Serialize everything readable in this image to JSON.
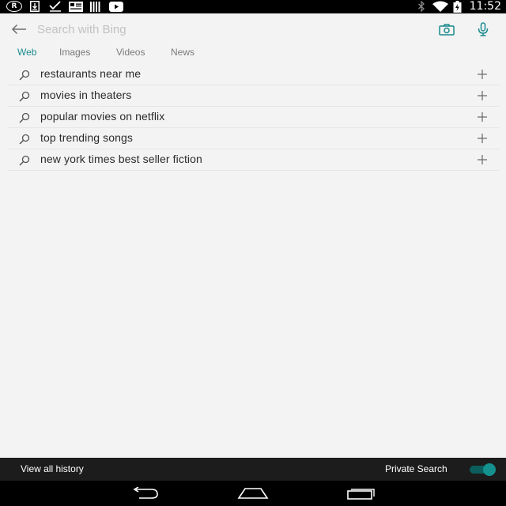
{
  "status_bar": {
    "time": "11:52",
    "left_icons": [
      "registered-icon",
      "download-icon",
      "checkmark-icon",
      "news-icon",
      "barcode-icon",
      "youtube-icon"
    ],
    "right_icons": [
      "bluetooth-icon",
      "wifi-icon",
      "battery-icon"
    ]
  },
  "search": {
    "placeholder": "Search with Bing",
    "value": "",
    "accent_color": "#1a8a8e"
  },
  "tabs": [
    {
      "label": "Web",
      "active": true
    },
    {
      "label": "Images",
      "active": false
    },
    {
      "label": "Videos",
      "active": false
    },
    {
      "label": "News",
      "active": false
    }
  ],
  "suggestions": [
    {
      "text": "restaurants near me"
    },
    {
      "text": "movies in theaters"
    },
    {
      "text": "popular movies on netflix"
    },
    {
      "text": "top trending songs"
    },
    {
      "text": "new york times best seller fiction"
    }
  ],
  "bottom_bar": {
    "history_label": "View all history",
    "private_label": "Private Search",
    "private_enabled": true
  },
  "nav_bar": {
    "buttons": [
      "back-nav-icon",
      "home-nav-icon",
      "recents-nav-icon"
    ]
  }
}
